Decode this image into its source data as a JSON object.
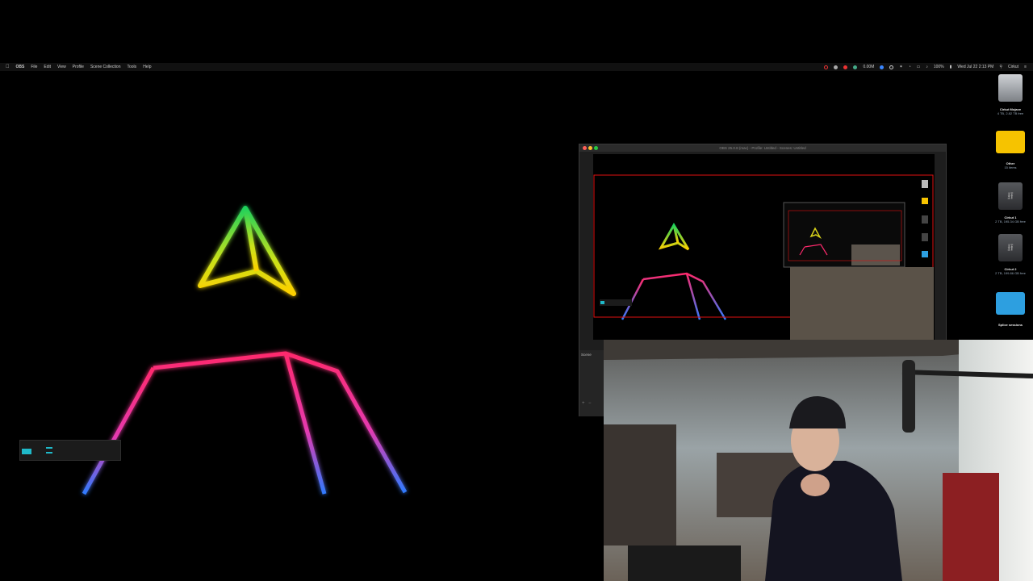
{
  "menubar": {
    "app_name": "OBS",
    "items": [
      "File",
      "Edit",
      "View",
      "Profile",
      "Scene Collection",
      "Tools",
      "Help"
    ],
    "net_rate": "0.00M",
    "battery": "100%",
    "clock": "Wed Jul 22  2:13 PM",
    "user": "Cirkut"
  },
  "desktop": {
    "icons": [
      {
        "name": "Cirkut Mojave",
        "sub": "4 TB, 2.82 TB free"
      },
      {
        "name": "Other",
        "sub": "15 items"
      },
      {
        "name": "Cirkut 1",
        "sub": "2 TB, 195.34 GB free"
      },
      {
        "name": "Cirkut 2",
        "sub": "2 TB, 199.86 GB free"
      },
      {
        "name": "Splice sessions",
        "sub": ""
      }
    ]
  },
  "obs_window": {
    "title": "OBS 25.0.8 (mac) - Profile: Untitled - Scenes: Untitled",
    "scenes_label": "Scene"
  },
  "colors": {
    "neon_pink": "#ff2a6d",
    "neon_blue": "#3b6bff",
    "neon_yellow": "#ffe600",
    "neon_green": "#29d84a",
    "selection_red": "#e01010",
    "folder_yellow": "#f6c300",
    "folder_blue": "#2d9fe0"
  }
}
